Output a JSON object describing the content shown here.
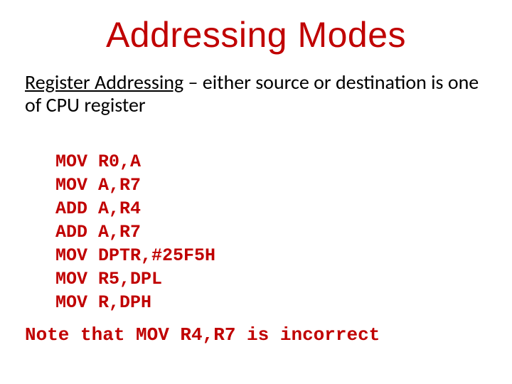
{
  "title": "Addressing Modes",
  "subtitle": {
    "mode_name": "Register Addressing",
    "rest": " – either source or destination is one of CPU register"
  },
  "code_lines": [
    "MOV R0,A",
    "MOV A,R7",
    "ADD A,R4",
    "ADD A,R7",
    "MOV DPTR,#25F5H",
    "MOV R5,DPL",
    "MOV R,DPH"
  ],
  "note": "Note that MOV R4,R7 is incorrect"
}
